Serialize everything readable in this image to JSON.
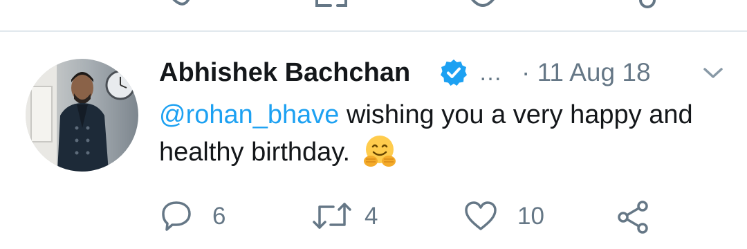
{
  "tweet": {
    "author_name": "Abhishek Bachchan",
    "verified": true,
    "ellipsis": "…",
    "date": "· 11 Aug 18",
    "mention": "@rohan_bhave",
    "text": " wishing you a very happy and healthy birthday.",
    "emoji": "hugging-face-emoji"
  },
  "actions": {
    "reply_count": "6",
    "retweet_count": "4",
    "like_count": "10"
  },
  "colors": {
    "link": "#1da1f2",
    "secondary_text": "#657786",
    "primary_text": "#14171a",
    "divider": "#e1e8ed"
  }
}
